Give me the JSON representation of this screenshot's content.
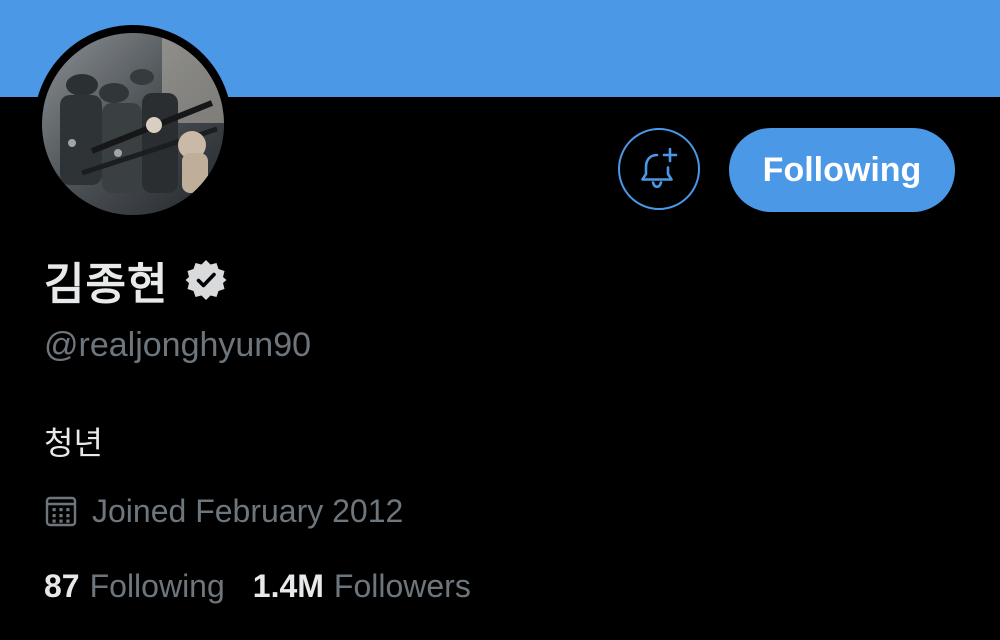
{
  "profile": {
    "display_name": "김종현",
    "handle": "@realjonghyun90",
    "bio": "청년",
    "joined": "Joined February 2012",
    "verified": true
  },
  "actions": {
    "follow_label": "Following",
    "bell_icon": "bell-plus-icon"
  },
  "stats": {
    "following_count": "87",
    "following_label": "Following",
    "followers_count": "1.4M",
    "followers_label": "Followers"
  },
  "colors": {
    "accent": "#4a98e6",
    "background": "#000000",
    "primary_text": "#e8e9ea",
    "secondary_text": "#6e767d"
  }
}
